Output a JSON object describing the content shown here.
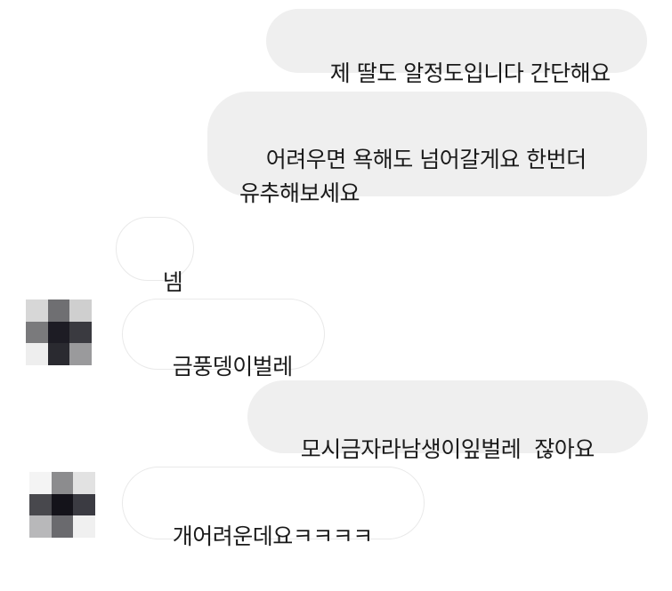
{
  "messages": [
    {
      "side": "sent",
      "text": "제 딸도 알정도입니다 간단해요"
    },
    {
      "side": "sent",
      "text": "어려우면 욕해도 넘어갈게요 한번더\n유추해보세요"
    },
    {
      "side": "received",
      "text": "넴"
    },
    {
      "side": "received",
      "text": "금풍뎅이벌레"
    },
    {
      "side": "sent",
      "text": "모시금자라남생이잎벌레  잖아요"
    },
    {
      "side": "received",
      "text": "개어려운데요ㅋㅋㅋㅋ"
    }
  ],
  "colors": {
    "sent_bubble": "#efefef",
    "received_border": "#e9e9e9",
    "text": "#1a1a1a"
  },
  "avatars": [
    {
      "icon": "pixelated-profile-icon"
    },
    {
      "icon": "pixelated-profile-icon"
    }
  ]
}
